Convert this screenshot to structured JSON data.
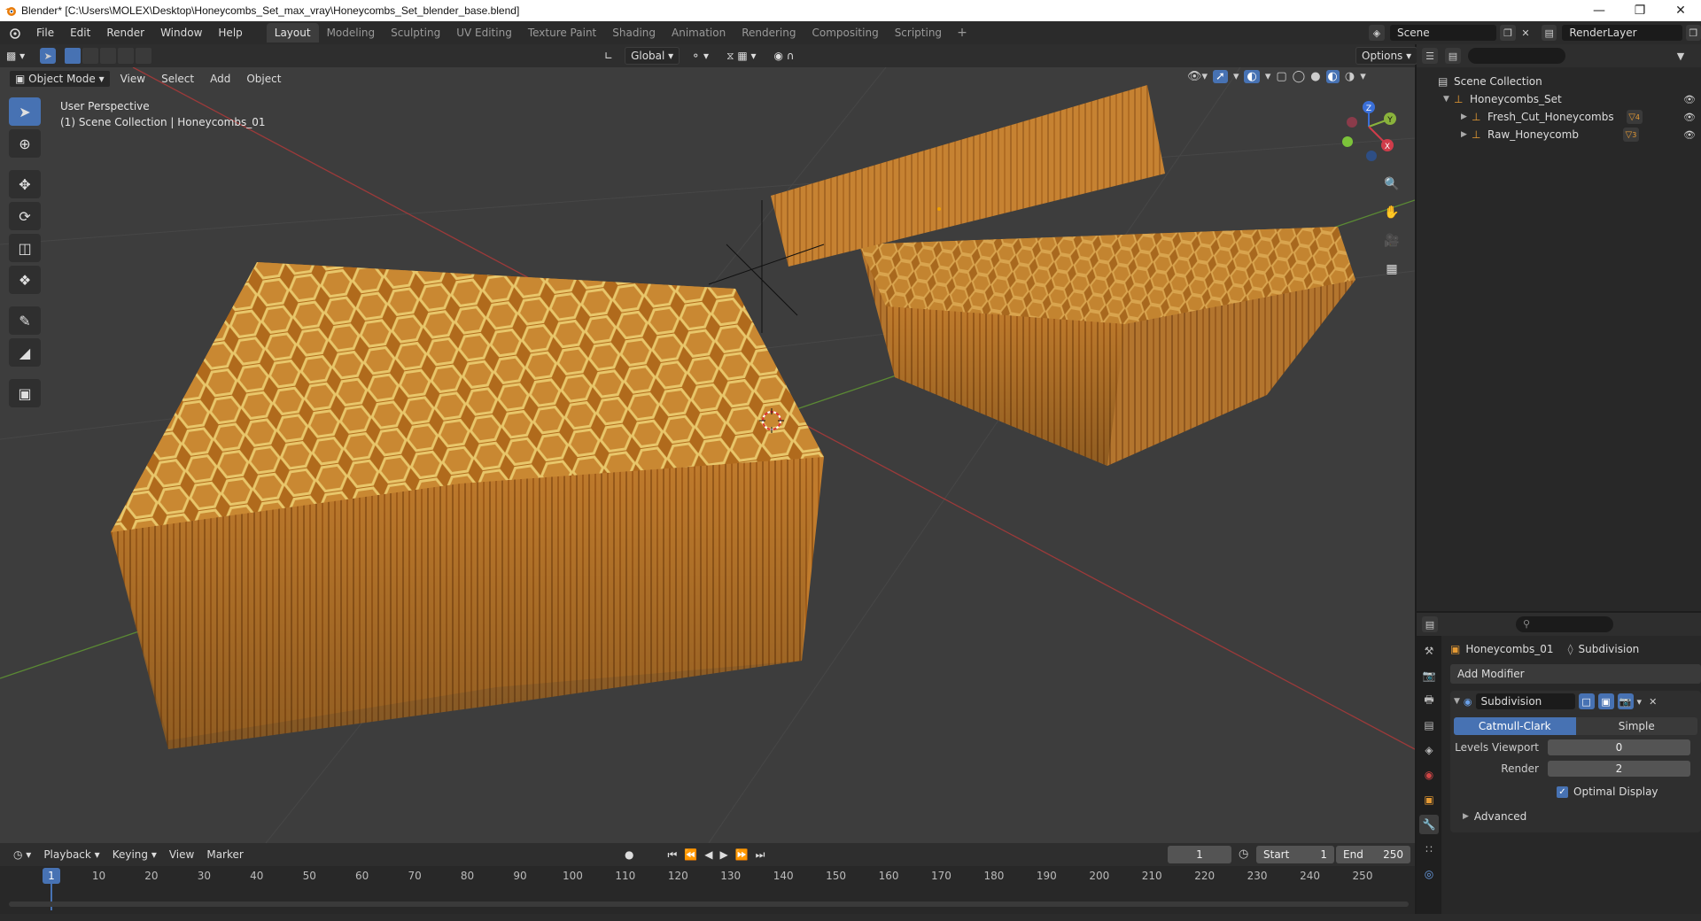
{
  "window": {
    "title": "Blender* [C:\\Users\\MOLEX\\Desktop\\Honeycombs_Set_max_vray\\Honeycombs_Set_blender_base.blend]",
    "min_icon": "minimize-icon",
    "max_icon": "restore-icon",
    "close_icon": "close-icon"
  },
  "menubar": {
    "items": [
      "File",
      "Edit",
      "Render",
      "Window",
      "Help"
    ],
    "workspaces": [
      "Layout",
      "Modeling",
      "Sculpting",
      "UV Editing",
      "Texture Paint",
      "Shading",
      "Animation",
      "Rendering",
      "Compositing",
      "Scripting"
    ],
    "active_workspace": "Layout",
    "add_symbol": "+",
    "scene_label": "Scene",
    "renderlayer_label": "RenderLayer"
  },
  "viewport_header": {
    "mode": "Object Mode",
    "menus": [
      "View",
      "Select",
      "Add",
      "Object"
    ],
    "orientation": "Global",
    "options_label": "Options"
  },
  "viewport": {
    "perspective": "User Perspective",
    "collection_info": "(1) Scene Collection | Honeycombs_01",
    "gizmo_axes": [
      "X",
      "Y",
      "Z"
    ]
  },
  "toolbar": {
    "tools": [
      "select-box-tool",
      "cursor-tool",
      "move-tool",
      "rotate-tool",
      "scale-tool",
      "transform-tool",
      "annotate-tool",
      "measure-tool",
      "add-cube-tool"
    ]
  },
  "outliner": {
    "search_placeholder": "",
    "root": "Scene Collection",
    "items": [
      {
        "label": "Honeycombs_Set",
        "level": 1,
        "expanded": true
      },
      {
        "label": "Fresh_Cut_Honeycombs",
        "level": 2,
        "badge": "4"
      },
      {
        "label": "Raw_Honeycomb",
        "level": 2,
        "badge": "3"
      }
    ]
  },
  "properties": {
    "object_name": "Honeycombs_01",
    "modifier_crumb": "Subdivision",
    "add_modifier_label": "Add Modifier",
    "modifier": {
      "name": "Subdivision",
      "type_options": [
        "Catmull-Clark",
        "Simple"
      ],
      "active_type": "Catmull-Clark",
      "levels_viewport_label": "Levels Viewport",
      "levels_viewport": "0",
      "render_label": "Render",
      "render_level": "2",
      "optimal_display_label": "Optimal Display",
      "optimal_display": true,
      "advanced_label": "Advanced"
    }
  },
  "timeline": {
    "menus": [
      "Playback",
      "Keying",
      "View",
      "Marker"
    ],
    "current_frame": "1",
    "start_label": "Start",
    "start": "1",
    "end_label": "End",
    "end": "250",
    "ticks": [
      "1",
      "10",
      "20",
      "30",
      "40",
      "50",
      "60",
      "70",
      "80",
      "90",
      "100",
      "110",
      "120",
      "130",
      "140",
      "150",
      "160",
      "170",
      "180",
      "190",
      "200",
      "210",
      "220",
      "230",
      "240",
      "250"
    ]
  },
  "colors": {
    "accent": "#4772b3",
    "honey": "#c8832a",
    "axis_x": "#b3403f",
    "axis_y": "#6a9a3a"
  }
}
